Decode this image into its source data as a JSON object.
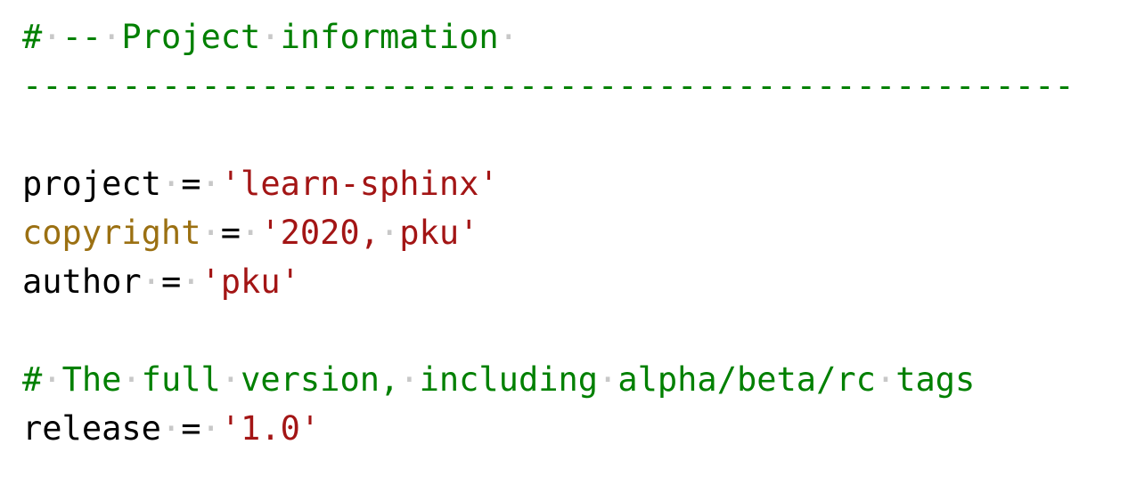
{
  "editor": {
    "name": "code-editor",
    "language": "python",
    "background_color": "#ffffff",
    "whitespace_dot": "·",
    "colors": {
      "comment": "#008000",
      "name": "#000000",
      "builtin": "#9b7012",
      "operator": "#000000",
      "string": "#a31515",
      "whitespace_marker": "#c8c8c8",
      "background": "#ffffff"
    }
  },
  "lines": [
    {
      "id": "line-1",
      "text": "# -- Project information -",
      "tokens": [
        {
          "t": "comment",
          "v": "#"
        },
        {
          "t": "ws",
          "v": " "
        },
        {
          "t": "comment",
          "v": "--"
        },
        {
          "t": "ws",
          "v": " "
        },
        {
          "t": "comment",
          "v": "Project"
        },
        {
          "t": "ws",
          "v": " "
        },
        {
          "t": "comment",
          "v": "information"
        },
        {
          "t": "ws",
          "v": " "
        }
      ]
    },
    {
      "id": "line-2",
      "text": "-----------------------------------------------------",
      "tokens": [
        {
          "t": "comment",
          "v": "-----------------------------------------------------"
        }
      ]
    },
    {
      "id": "line-3",
      "text": "",
      "tokens": []
    },
    {
      "id": "line-4",
      "text": "project = 'learn-sphinx'",
      "tokens": [
        {
          "t": "name",
          "v": "project"
        },
        {
          "t": "ws",
          "v": " "
        },
        {
          "t": "operator",
          "v": "="
        },
        {
          "t": "ws",
          "v": " "
        },
        {
          "t": "string",
          "v": "'learn-sphinx'"
        }
      ]
    },
    {
      "id": "line-5",
      "text": "copyright = '2020, pku'",
      "tokens": [
        {
          "t": "builtin",
          "v": "copyright"
        },
        {
          "t": "ws",
          "v": " "
        },
        {
          "t": "operator",
          "v": "="
        },
        {
          "t": "ws",
          "v": " "
        },
        {
          "t": "string",
          "v": "'2020,"
        },
        {
          "t": "ws",
          "v": " "
        },
        {
          "t": "string",
          "v": "pku'"
        }
      ]
    },
    {
      "id": "line-6",
      "text": "author = 'pku'",
      "tokens": [
        {
          "t": "name",
          "v": "author"
        },
        {
          "t": "ws",
          "v": " "
        },
        {
          "t": "operator",
          "v": "="
        },
        {
          "t": "ws",
          "v": " "
        },
        {
          "t": "string",
          "v": "'pku'"
        }
      ]
    },
    {
      "id": "line-7",
      "text": "",
      "tokens": []
    },
    {
      "id": "line-8",
      "text": "# The full version, including alpha/beta/rc tags",
      "tokens": [
        {
          "t": "comment",
          "v": "#"
        },
        {
          "t": "ws",
          "v": " "
        },
        {
          "t": "comment",
          "v": "The"
        },
        {
          "t": "ws",
          "v": " "
        },
        {
          "t": "comment",
          "v": "full"
        },
        {
          "t": "ws",
          "v": " "
        },
        {
          "t": "comment",
          "v": "version,"
        },
        {
          "t": "ws",
          "v": " "
        },
        {
          "t": "comment",
          "v": "including"
        },
        {
          "t": "ws",
          "v": " "
        },
        {
          "t": "comment",
          "v": "alpha/beta/rc"
        },
        {
          "t": "ws",
          "v": " "
        },
        {
          "t": "comment",
          "v": "tags"
        }
      ]
    },
    {
      "id": "line-9",
      "text": "release = '1.0'",
      "tokens": [
        {
          "t": "name",
          "v": "release"
        },
        {
          "t": "ws",
          "v": " "
        },
        {
          "t": "operator",
          "v": "="
        },
        {
          "t": "ws",
          "v": " "
        },
        {
          "t": "string",
          "v": "'1.0'"
        }
      ]
    }
  ]
}
